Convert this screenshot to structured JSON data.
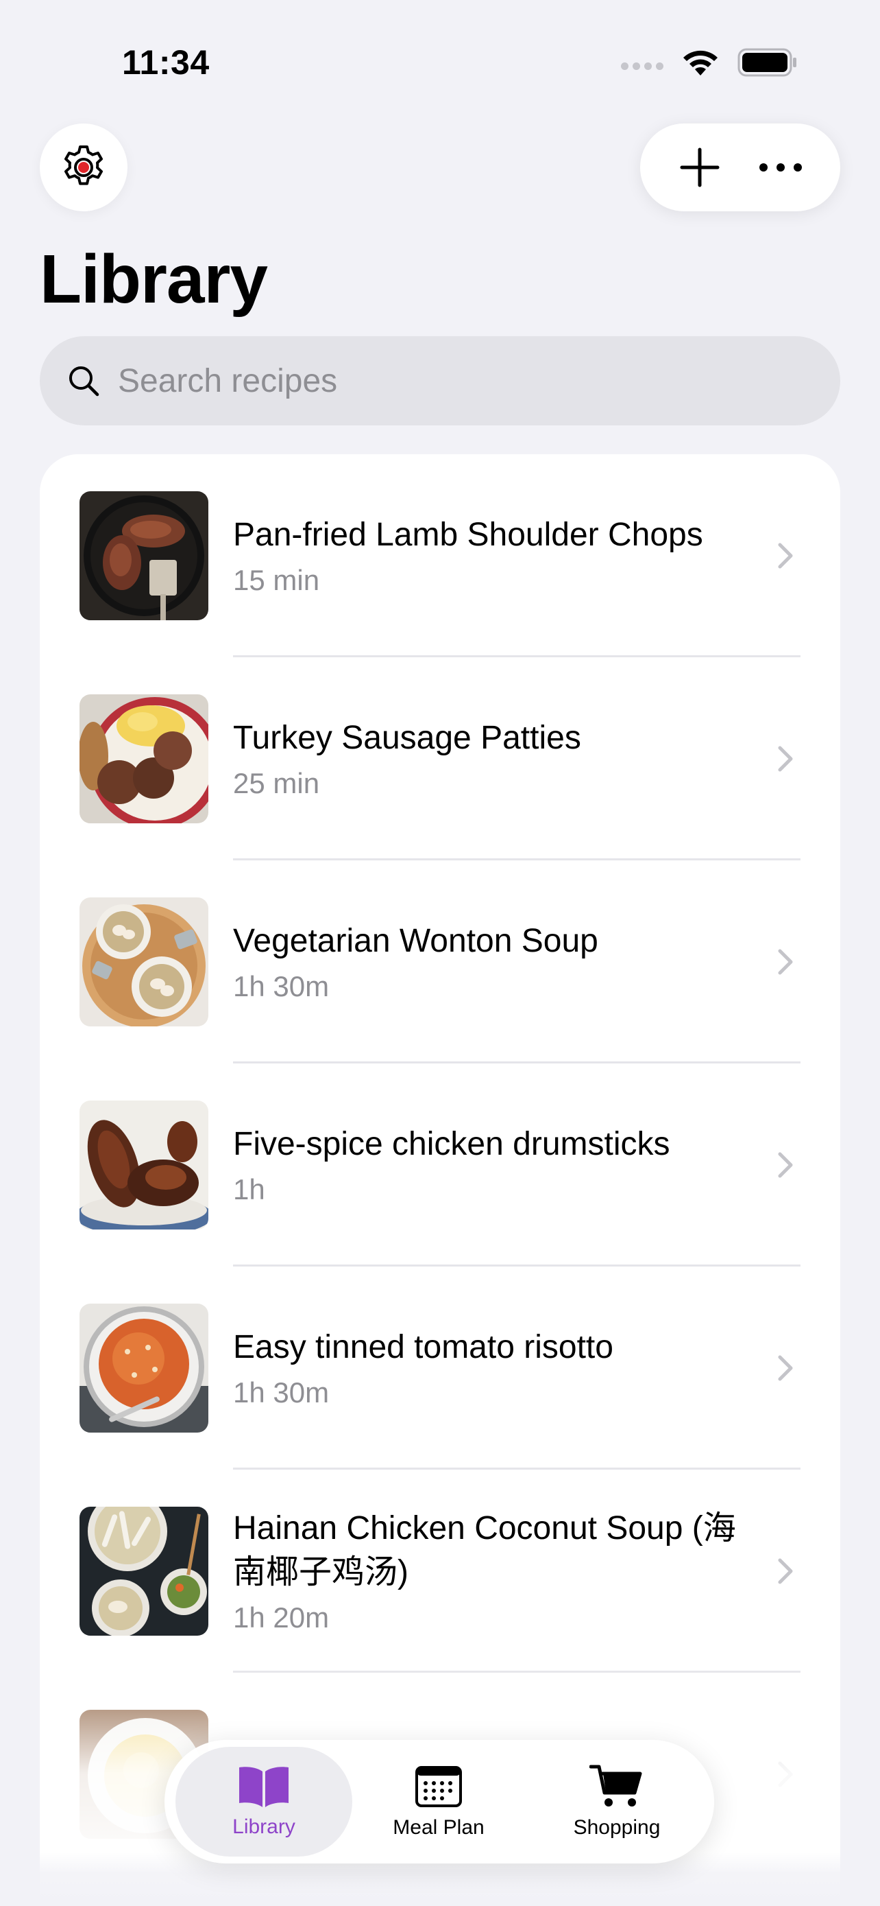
{
  "status_bar": {
    "time": "11:34"
  },
  "header": {
    "title": "Library",
    "settings_icon": "gear-icon",
    "add_icon": "plus-icon",
    "more_icon": "ellipsis-icon"
  },
  "search": {
    "placeholder": "Search recipes",
    "value": ""
  },
  "recipes": [
    {
      "title": "Pan-fried Lamb Shoulder Chops",
      "time": "15 min"
    },
    {
      "title": "Turkey Sausage Patties",
      "time": "25 min"
    },
    {
      "title": "Vegetarian Wonton Soup",
      "time": "1h 30m"
    },
    {
      "title": "Five-spice chicken drumsticks",
      "time": "1h"
    },
    {
      "title": "Easy tinned tomato risotto",
      "time": "1h 30m"
    },
    {
      "title": "Hainan Chicken Coconut Soup (海南椰子鸡汤)",
      "time": "1h 20m"
    }
  ],
  "tabs": [
    {
      "label": "Library",
      "icon": "book-icon",
      "active": true
    },
    {
      "label": "Meal Plan",
      "icon": "calendar-icon",
      "active": false
    },
    {
      "label": "Shopping",
      "icon": "cart-icon",
      "active": false
    }
  ],
  "colors": {
    "accent": "#8e44c9",
    "background": "#f2f2f7",
    "settings_dot": "#e0262b"
  }
}
